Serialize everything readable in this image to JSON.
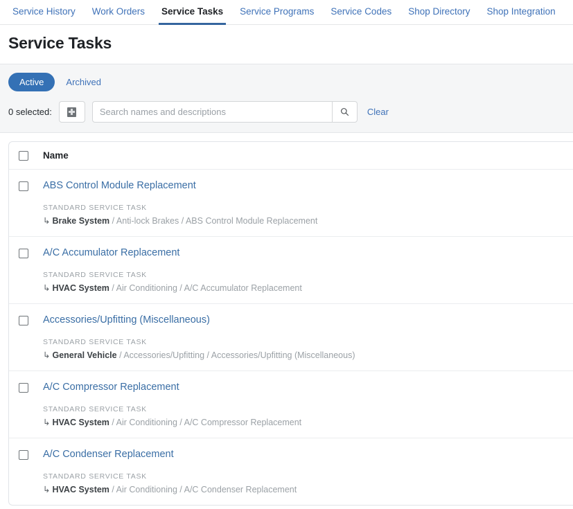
{
  "nav": {
    "tabs": [
      {
        "label": "Service History",
        "active": false
      },
      {
        "label": "Work Orders",
        "active": false
      },
      {
        "label": "Service Tasks",
        "active": true
      },
      {
        "label": "Service Programs",
        "active": false
      },
      {
        "label": "Service Codes",
        "active": false
      },
      {
        "label": "Shop Directory",
        "active": false
      },
      {
        "label": "Shop Integration",
        "active": false
      }
    ]
  },
  "header": {
    "title": "Service Tasks"
  },
  "filters": {
    "segments": [
      {
        "label": "Active",
        "selected": true
      },
      {
        "label": "Archived",
        "selected": false
      }
    ],
    "selected_count_label": "0 selected:",
    "batch_action_icon": "batch-action-icon",
    "search": {
      "placeholder": "Search names and descriptions",
      "value": "",
      "search_icon": "search-icon"
    },
    "clear_label": "Clear"
  },
  "table": {
    "columns": [
      "Name"
    ],
    "rows": [
      {
        "name": "ABS Control Module Replacement",
        "kind": "STANDARD SERVICE TASK",
        "path_arrow": "↳",
        "path_root": "Brake System",
        "path_rest": " / Anti-lock Brakes / ABS Control Module Replacement"
      },
      {
        "name": "A/C Accumulator Replacement",
        "kind": "STANDARD SERVICE TASK",
        "path_arrow": "↳",
        "path_root": "HVAC System",
        "path_rest": " / Air Conditioning / A/C Accumulator Replacement"
      },
      {
        "name": "Accessories/Upfitting (Miscellaneous)",
        "kind": "STANDARD SERVICE TASK",
        "path_arrow": "↳",
        "path_root": "General Vehicle",
        "path_rest": " / Accessories/Upfitting / Accessories/Upfitting (Miscellaneous)"
      },
      {
        "name": "A/C Compressor Replacement",
        "kind": "STANDARD SERVICE TASK",
        "path_arrow": "↳",
        "path_root": "HVAC System",
        "path_rest": " / Air Conditioning / A/C Compressor Replacement"
      },
      {
        "name": "A/C Condenser Replacement",
        "kind": "STANDARD SERVICE TASK",
        "path_arrow": "↳",
        "path_root": "HVAC System",
        "path_rest": " / Air Conditioning / A/C Condenser Replacement"
      }
    ]
  },
  "colors": {
    "link": "#3f72b8",
    "accent": "#3471b5",
    "active_tab_underline": "#35659e",
    "filter_bar_bg": "#f5f6f7",
    "border": "#e4e6e8"
  }
}
